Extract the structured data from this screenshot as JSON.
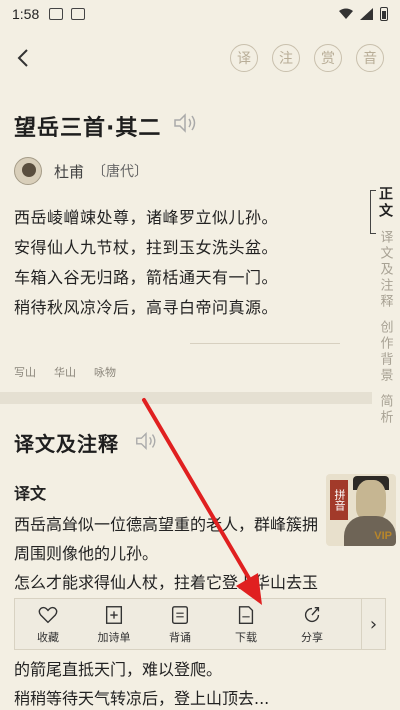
{
  "status_bar": {
    "time": "1:58"
  },
  "header": {
    "back_icon": "chevron-left-icon",
    "buttons": [
      {
        "label": "译",
        "name": "translate-button"
      },
      {
        "label": "注",
        "name": "annotate-button"
      },
      {
        "label": "赏",
        "name": "appreciate-button"
      },
      {
        "label": "音",
        "name": "audio-button"
      }
    ]
  },
  "poem": {
    "title": "望岳三首·其二",
    "author": "杜甫",
    "dynasty": "〔唐代〕",
    "lines": [
      "西岳崚嶒竦处尊，诸峰罗立似儿孙。",
      "安得仙人九节杖，拄到玉女洗头盆。",
      "车箱入谷无归路，箭栝通天有一门。",
      "稍待秋风凉冷后，高寻白帝问真源。"
    ],
    "tags": [
      "写山",
      "华山",
      "咏物"
    ]
  },
  "side_tabs": [
    {
      "label": "正文",
      "active": true
    },
    {
      "label": "译文及注释",
      "active": false
    },
    {
      "label": "创作背景",
      "active": false
    },
    {
      "label": "简析",
      "active": false
    }
  ],
  "section": {
    "title": "译文及注释",
    "subtitle": "译文",
    "lines": [
      "西岳高耸似一位德高望重的老人，群峰簇拥",
      "周围则像他的儿孙。",
      "怎么才能求得仙人杖，拄着它登上华山去玉"
    ],
    "after_lines": [
      "的箭尾直抵天门，难以登爬。",
      "稍稍等待天气转凉后，登上山顶去..."
    ]
  },
  "vip_badge": {
    "text": "拼音",
    "vip": "VIP"
  },
  "action_bar": {
    "items": [
      {
        "label": "收藏",
        "icon": "heart-icon",
        "name": "favorite-button"
      },
      {
        "label": "加诗单",
        "icon": "plus-box-icon",
        "name": "add-to-list-button"
      },
      {
        "label": "背诵",
        "icon": "recite-icon",
        "name": "recite-button"
      },
      {
        "label": "下载",
        "icon": "pdf-icon",
        "name": "download-button"
      },
      {
        "label": "分享",
        "icon": "share-icon",
        "name": "share-button"
      }
    ],
    "more_icon": "chevron-right-icon"
  },
  "colors": {
    "background": "#f3efe3",
    "arrow": "#e02020",
    "text": "#222222"
  }
}
